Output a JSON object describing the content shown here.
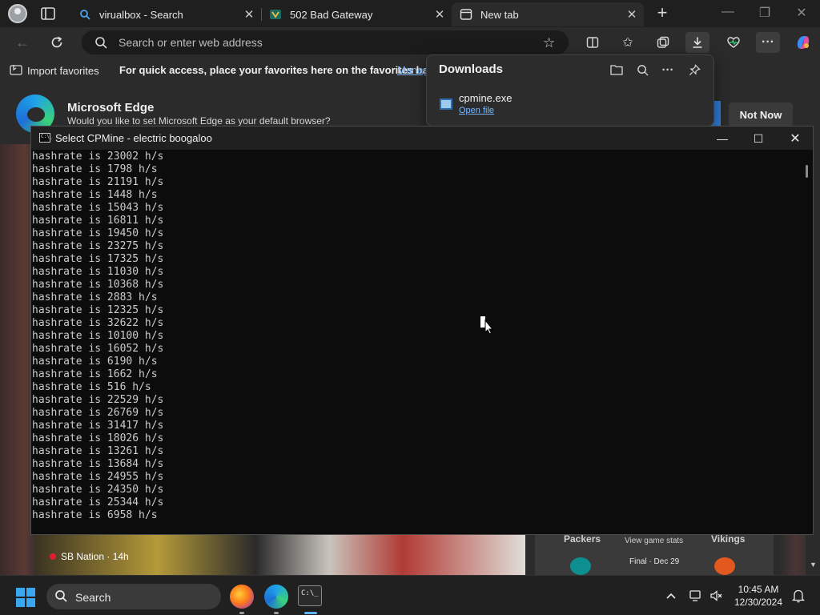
{
  "browser": {
    "tabs": [
      {
        "label": "virualbox - Search",
        "icon": "search-icon"
      },
      {
        "label": "502 Bad Gateway",
        "icon": "vault-icon"
      },
      {
        "label": "New tab",
        "icon": "newtab-icon"
      }
    ],
    "new_tab_icon": "+",
    "address_placeholder": "Search or enter web address",
    "favorites_bar": {
      "import_label": "Import favorites",
      "message": "For quick access, place your favorites here on the favorites bar.",
      "manage_label": "Manag"
    }
  },
  "downloads": {
    "title": "Downloads",
    "file_name": "cpmine.exe",
    "open_label": "Open file"
  },
  "edge_banner": {
    "title": "Microsoft Edge",
    "message": "Would you like to set Microsoft Edge as your default browser?",
    "not_now_label": "Not Now"
  },
  "news": {
    "source": "SB Nation · 14h"
  },
  "sports": {
    "team_a": "Packers",
    "team_b": "Vikings",
    "link": "View game stats",
    "status": "Final · Dec 29"
  },
  "console": {
    "title": "Select CPMine - electric boogaloo",
    "icon_text": "C:\\_",
    "lines": [
      "hashrate is 23002 h/s",
      "hashrate is 1798 h/s",
      "hashrate is 21191 h/s",
      "hashrate is 1448 h/s",
      "hashrate is 15043 h/s",
      "hashrate is 16811 h/s",
      "hashrate is 19450 h/s",
      "hashrate is 23275 h/s",
      "hashrate is 17325 h/s",
      "hashrate is 11030 h/s",
      "hashrate is 10368 h/s",
      "hashrate is 2883 h/s",
      "hashrate is 12325 h/s",
      "hashrate is 32622 h/s",
      "hashrate is 10100 h/s",
      "hashrate is 16052 h/s",
      "hashrate is 6190 h/s",
      "hashrate is 1662 h/s",
      "hashrate is 516 h/s",
      "hashrate is 22529 h/s",
      "hashrate is 26769 h/s",
      "hashrate is 31417 h/s",
      "hashrate is 18026 h/s",
      "hashrate is 13261 h/s",
      "hashrate is 13684 h/s",
      "hashrate is 24955 h/s",
      "hashrate is 24350 h/s",
      "hashrate is 25344 h/s",
      "hashrate is 6958 h/s"
    ]
  },
  "taskbar": {
    "search_label": "Search",
    "time": "10:45 AM",
    "date": "12/30/2024",
    "terminal_icon_text": "C:\\_"
  },
  "colors": {
    "accent": "#3aa8f0",
    "link": "#79b8ff",
    "console_bg": "#0c0c0c",
    "console_text": "#cccccc"
  }
}
